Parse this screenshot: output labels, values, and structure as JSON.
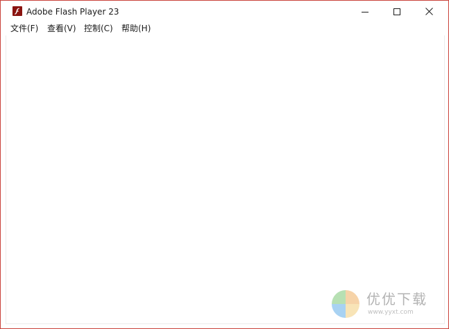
{
  "window": {
    "title": "Adobe Flash Player 23",
    "app_icon": "flash-player-icon",
    "border_color": "#c9413a"
  },
  "controls": {
    "minimize_icon": "minimize-icon",
    "maximize_icon": "maximize-icon",
    "close_icon": "close-icon"
  },
  "menu": {
    "items": [
      {
        "label": "文件(F)"
      },
      {
        "label": "查看(V)"
      },
      {
        "label": "控制(C)"
      },
      {
        "label": "帮助(H)"
      }
    ]
  },
  "watermark": {
    "brand": "优优下载",
    "url": "www.yyxt.com"
  }
}
